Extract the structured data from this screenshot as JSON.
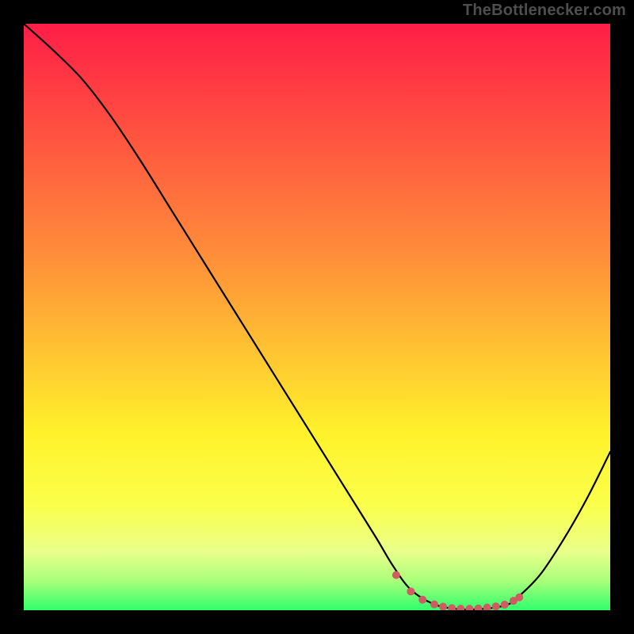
{
  "attribution": "TheBottlenecker.com",
  "chart_data": {
    "type": "line",
    "title": "",
    "xlabel": "",
    "ylabel": "",
    "xlim": [
      0,
      100
    ],
    "ylim": [
      0,
      100
    ],
    "background_gradient": {
      "stops": [
        {
          "offset": 0,
          "color": "#ff1e47"
        },
        {
          "offset": 20,
          "color": "#ff5640"
        },
        {
          "offset": 40,
          "color": "#ff8f39"
        },
        {
          "offset": 55,
          "color": "#ffc132"
        },
        {
          "offset": 70,
          "color": "#fff22b"
        },
        {
          "offset": 82,
          "color": "#fbff4a"
        },
        {
          "offset": 90,
          "color": "#e9ff8a"
        },
        {
          "offset": 95,
          "color": "#a9ff7a"
        },
        {
          "offset": 100,
          "color": "#2fff6d"
        }
      ]
    },
    "series": [
      {
        "name": "bottleneck-curve",
        "stroke": "#000000",
        "stroke_width": 2.2,
        "x": [
          0,
          5,
          10,
          15,
          20,
          25,
          30,
          35,
          40,
          45,
          50,
          55,
          60,
          63,
          66,
          70,
          74,
          78,
          82,
          84,
          88,
          92,
          96,
          100
        ],
        "y": [
          100,
          95.5,
          90.5,
          84,
          76.5,
          68.5,
          60.5,
          52.5,
          44.5,
          36.5,
          28.5,
          20.5,
          12.5,
          7.5,
          3.5,
          1.0,
          0.2,
          0.2,
          0.8,
          2.0,
          6.0,
          12.0,
          19.0,
          27.0
        ]
      }
    ],
    "markers": {
      "name": "flat-zone-dots",
      "color": "#cf5b63",
      "radius": 5,
      "x": [
        63.5,
        66,
        68,
        70,
        71.5,
        73,
        74.5,
        76,
        77.5,
        79,
        80.5,
        82,
        83.5,
        84.5
      ],
      "y": [
        6.0,
        3.2,
        1.8,
        1.0,
        0.6,
        0.35,
        0.25,
        0.25,
        0.3,
        0.45,
        0.65,
        0.95,
        1.6,
        2.2
      ]
    }
  }
}
